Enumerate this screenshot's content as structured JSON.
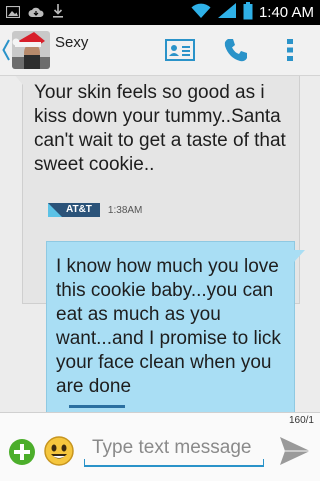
{
  "status_bar": {
    "time": "1:40 AM",
    "icons": [
      "image-icon",
      "cloud-icon",
      "download-icon",
      "wifi-icon",
      "signal-icon",
      "battery-icon"
    ]
  },
  "action_bar": {
    "contact_name": "Sexy",
    "icons": [
      "back-chevron-icon",
      "contact-card-icon",
      "phone-icon",
      "overflow-menu-icon"
    ]
  },
  "messages": [
    {
      "direction": "incoming",
      "text": "Your skin feels so good as i kiss down your tummy..Santa can't wait to get a taste of that sweet cookie..",
      "carrier": "AT&T",
      "time": "1:38AM"
    },
    {
      "direction": "outgoing",
      "text": "I know how much you love this cookie baby...you can eat as much as you want...and I promise to lick your face clean when you are done"
    }
  ],
  "compose": {
    "char_count": "160/1",
    "placeholder": "Type text message",
    "icons": [
      "add-icon",
      "emoji-icon",
      "send-icon"
    ]
  },
  "colors": {
    "incoming_bubble": "#e5e5e5",
    "outgoing_bubble": "#a9def4",
    "accent": "#2a93c9",
    "add_green": "#4cae2b"
  }
}
